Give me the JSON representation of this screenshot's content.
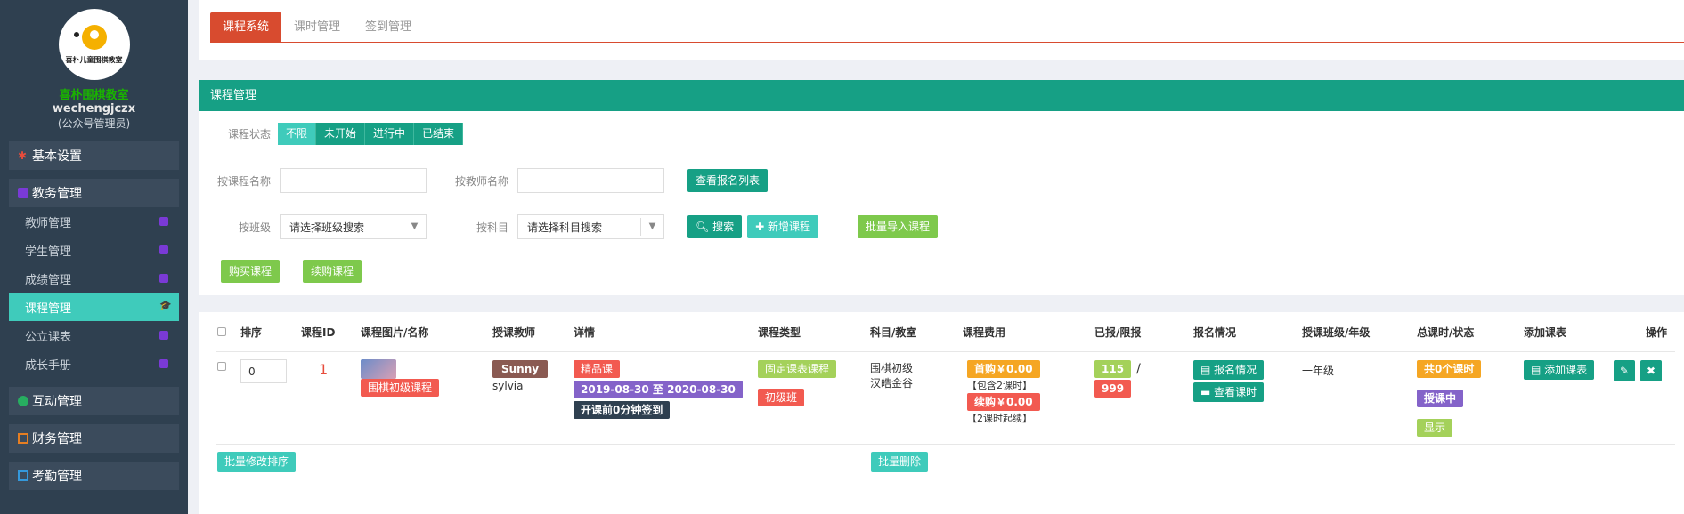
{
  "sidebar": {
    "logo_text": "喜朴儿童围棋教室",
    "school": "喜朴围棋教室",
    "account": "wechengjczx",
    "role": "(公众号管理员)",
    "groups": [
      {
        "label": "基本设置",
        "icon": "gear-icon"
      },
      {
        "label": "教务管理",
        "icon": "book-icon"
      }
    ],
    "items": [
      {
        "label": "教师管理"
      },
      {
        "label": "学生管理"
      },
      {
        "label": "成绩管理"
      },
      {
        "label": "课程管理"
      },
      {
        "label": "公立课表"
      },
      {
        "label": "成长手册"
      }
    ],
    "groups2": [
      {
        "label": "互动管理"
      },
      {
        "label": "财务管理"
      },
      {
        "label": "考勤管理"
      }
    ]
  },
  "tabs": [
    "课程系统",
    "课时管理",
    "签到管理"
  ],
  "panel": {
    "title": "课程管理",
    "status_label": "课程状态",
    "status_options": [
      "不限",
      "未开始",
      "进行中",
      "已结束"
    ],
    "course_name_label": "按课程名称",
    "teacher_name_label": "按教师名称",
    "view_signup_btn": "查看报名列表",
    "class_label": "按班级",
    "class_select": "请选择班级搜索",
    "subject_label": "按科目",
    "subject_select": "请选择科目搜索",
    "search_btn": "搜索",
    "add_course_btn": "新增课程",
    "import_btn": "批量导入课程",
    "buy_btn": "购买课程",
    "renew_btn": "续购课程"
  },
  "table": {
    "headers": [
      "排序",
      "课程ID",
      "课程图片/名称",
      "授课教师",
      "详情",
      "课程类型",
      "科目/教室",
      "课程费用",
      "已报/限报",
      "报名情况",
      "授课班级/年级",
      "总课时/状态",
      "添加课表",
      "操作"
    ],
    "row": {
      "sort": "0",
      "id": "1",
      "name": "围棋初级课程",
      "teacher": "Sunny",
      "teacher_sub": "sylvia",
      "tag_quality": "精品课",
      "date_range": "2019-08-30 至 2020-08-30",
      "checkin": "开课前0分钟签到",
      "type": "固定课表课程",
      "level": "初级班",
      "subject": "围棋初级",
      "room": "汉皓金谷",
      "fee_first": "首购￥0.00",
      "fee_first_note": "【包含2课时】",
      "fee_renew": "续购￥0.00",
      "fee_renew_note": "【2课时起续】",
      "enrolled": "115",
      "slash": "/",
      "limit": "999",
      "signup_btn": "报名情况",
      "hours_btn": "查看课时",
      "grade": "一年级",
      "total_hours": "共0个课时",
      "state": "授课中",
      "show": "显示",
      "add_schedule": "添加课表"
    },
    "batch_sort": "批量修改排序",
    "batch_delete": "批量删除"
  }
}
